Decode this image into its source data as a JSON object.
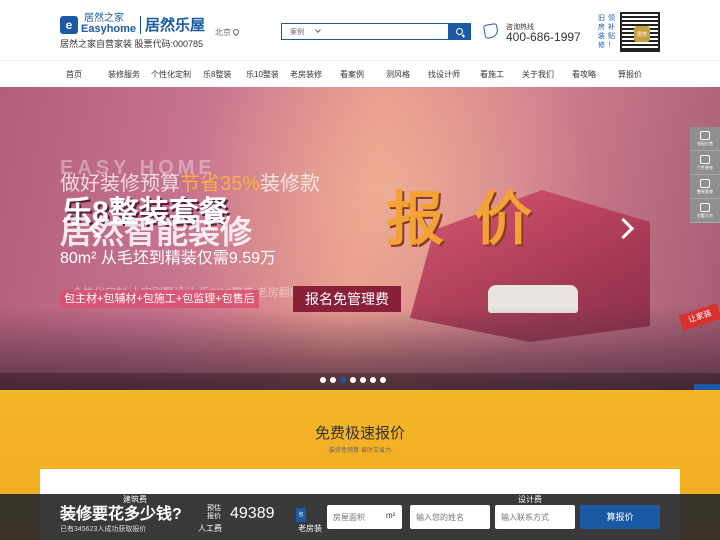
{
  "header": {
    "logo_mark": "e",
    "logo_cn": "居然之家",
    "logo_en": "Easyhome",
    "brand": "居然乐屋",
    "subtitle": "居然之家自营家装  股票代码:000785",
    "city": "北京",
    "search": {
      "category": "案例",
      "placeholder": ""
    },
    "hotline_label": "咨询热线",
    "hotline_number": "400-686-1997",
    "qr_side_text": [
      "旧",
      "领",
      "房",
      "补",
      "装",
      "贴",
      "修",
      "！"
    ],
    "qr_center": "居然"
  },
  "nav": {
    "items": [
      "首页",
      "装修服务",
      "个性化定制",
      "乐8整装",
      "乐10整装",
      "老房装修",
      "看案例",
      "测风格",
      "找设计师",
      "看施工",
      "关于我们",
      "看攻略",
      "算报价"
    ]
  },
  "banner": {
    "faint_text": "EASY HOME",
    "headline1_a": "做好装修预算",
    "headline1_b": "节省35%",
    "headline1_c": "装修款",
    "headline2": "乐8整装套餐",
    "headline3": "居然智能装修",
    "big_text": "报价",
    "sub": "80m² 从毛坯到精装仅需9.59万",
    "faint_row": "个性化定制    大宅别墅设计    乐8/10整装    老房翻新改造    局部改造升级",
    "pills": "包主材+包辅材+包施工+包监理+包售后",
    "cta": "报名免管理费",
    "tag": "让家装",
    "slide_count": 7,
    "active_slide": 2
  },
  "side_float": [
    {
      "icon": "gift-icon",
      "label": "领报价费"
    },
    {
      "icon": "calendar-icon",
      "label": "个性装修"
    },
    {
      "icon": "paint-roller-icon",
      "label": "整装套餐"
    },
    {
      "icon": "house-icon",
      "label": "别墅大宅"
    }
  ],
  "side_float2": [
    {
      "icon": "chat-icon"
    },
    {
      "icon": "home-icon"
    },
    {
      "icon": "qrcode-icon"
    }
  ],
  "quote": {
    "title": "免费极速报价",
    "subtitle": "-装修免预算·省时又省力-"
  },
  "bottom_bar": {
    "title": "装修要花多少钱?",
    "stat": "已有345623人成功获取报价",
    "est_label": "预估报价",
    "amount": "49389",
    "badge": "省",
    "area_placeholder": "房屋面积",
    "unit": "m²",
    "name_placeholder": "输入您的姓名",
    "phone_placeholder": "输入联系方式",
    "button": "算报价",
    "overlap_labels": [
      "建筑费",
      "人工费",
      "老房装",
      "设计费"
    ]
  }
}
